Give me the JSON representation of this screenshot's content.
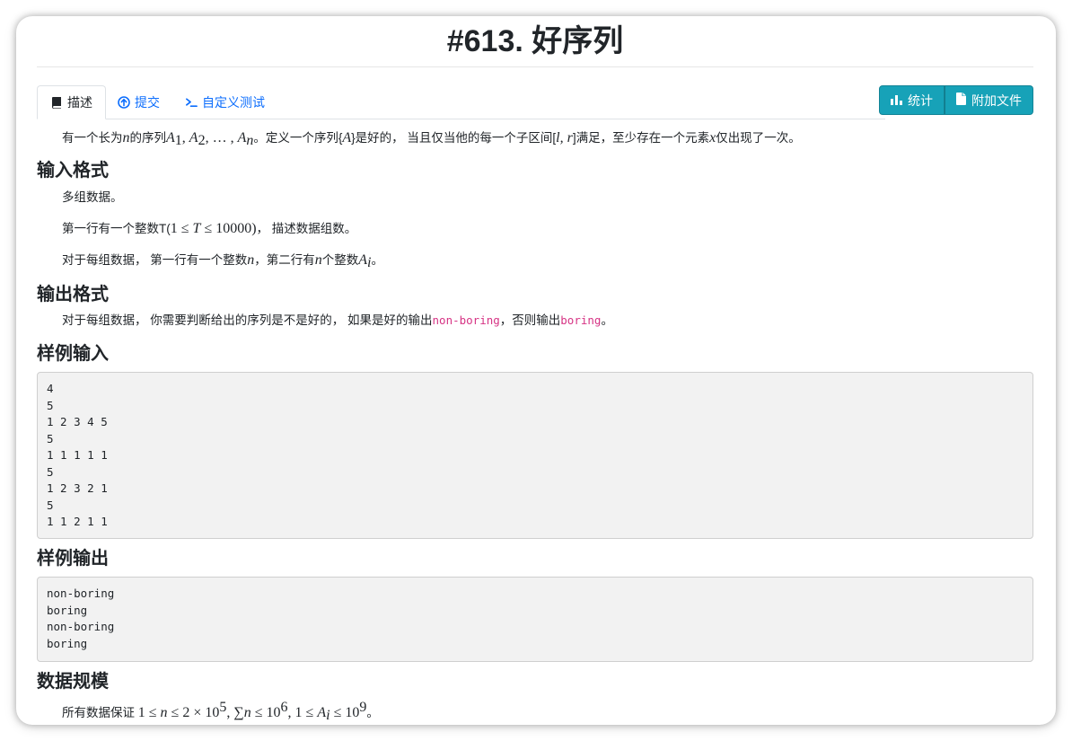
{
  "problem": {
    "title": "#613. 好序列"
  },
  "tabs": [
    {
      "label": "描述",
      "icon": "book-icon"
    },
    {
      "label": "提交",
      "icon": "upload-circle-icon"
    },
    {
      "label": "自定义测试",
      "icon": "terminal-icon"
    }
  ],
  "actions": [
    {
      "label": "统计",
      "icon": "bar-chart-icon"
    },
    {
      "label": "附加文件",
      "icon": "file-icon"
    }
  ],
  "description": {
    "t1": "有一个长为",
    "t2": "n",
    "t3": "的序列",
    "t4": "A",
    "t5": "1",
    "t6": ", ",
    "t7": "A",
    "t8": "2",
    "t9": ", … , ",
    "t10": "A",
    "t11": "n",
    "t12": "。定义一个序列{",
    "t13": "A",
    "t14": "}是好的， 当且仅当他的每一个子区间[",
    "t15": "l, r",
    "t16": "]满足，至少存在一个元素",
    "t17": "x",
    "t18": "仅出现了一次。"
  },
  "sections": {
    "input": "输入格式",
    "output": "输出格式",
    "sample_in": "样例输入",
    "sample_out": "样例输出",
    "limits": "数据规模"
  },
  "input_format": {
    "p1": "多组数据。",
    "p2a": "第一行有一个整数T(",
    "p2b": "1 ≤ ",
    "p2c": "T",
    "p2d": " ≤ 10000)",
    "p2e": "， 描述数据组数。",
    "p3a": "对于每组数据， 第一行有一个整数",
    "p3b": "n",
    "p3c": "，第二行有",
    "p3d": "n",
    "p3e": "个整数",
    "p3f": "A",
    "p3g": "i",
    "p3h": "。"
  },
  "output_format": {
    "a": "对于每组数据， 你需要判断给出的序列是不是好的， 如果是好的输出",
    "b": "non-boring",
    "c": "，否则输出",
    "d": "boring",
    "e": "。"
  },
  "sample_input": "4\n5\n1 2 3 4 5\n5\n1 1 1 1 1\n5\n1 2 3 2 1\n5\n1 1 2 1 1",
  "sample_output": "non-boring\nboring\nnon-boring\nboring",
  "limits": {
    "a": "所有数据保证 ",
    "b": "1 ≤ ",
    "c": "n",
    "d": " ≤ 2 × 10",
    "e": "5",
    "f": ", ∑",
    "g": "n",
    "h": " ≤ 10",
    "i": "6",
    "j": ", 1 ≤ ",
    "k": "A",
    "l": "i",
    "m": " ≤ 10",
    "n": "9",
    "o": "。"
  }
}
